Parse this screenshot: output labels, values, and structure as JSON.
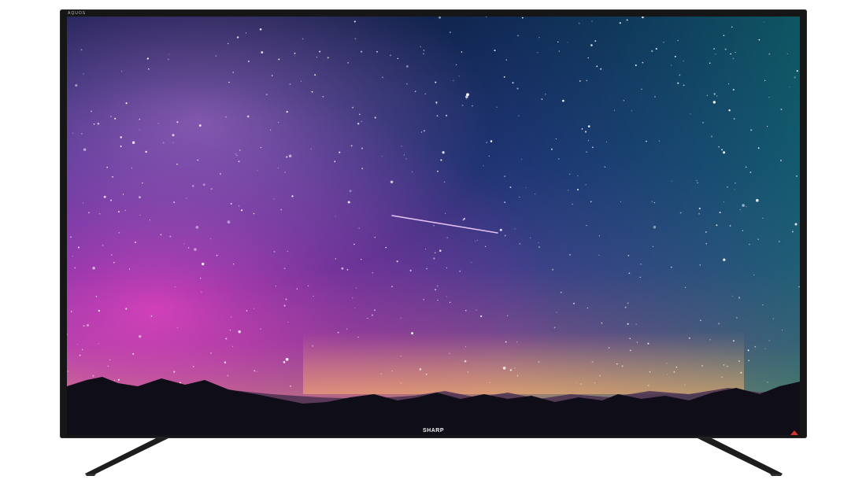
{
  "tv": {
    "brand_top_left": "AQUOS",
    "brand_bottom": "SHARP"
  },
  "icons": {
    "power_indicator": "power-led-icon"
  },
  "colors": {
    "bezel": "#161616",
    "stand": "#1d1d1d",
    "power_led": "#d8342e",
    "sky_top": "#141a4a",
    "sky_horizon": "#f2a07a"
  }
}
